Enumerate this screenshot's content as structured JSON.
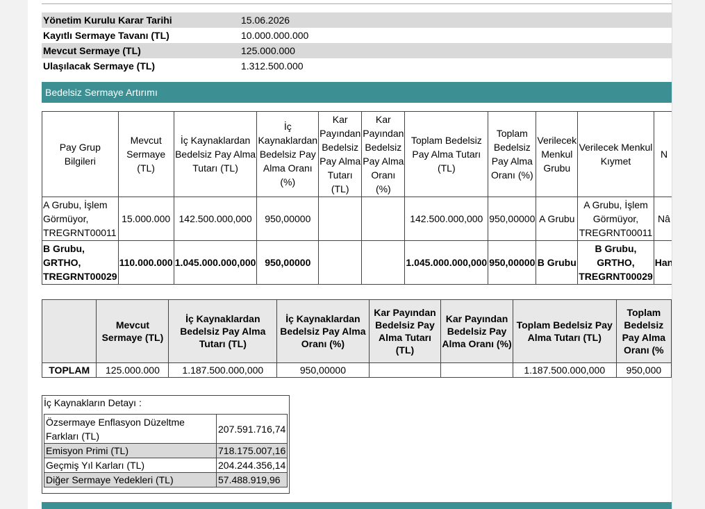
{
  "info_rows": [
    {
      "label": "Yönetim Kurulu Karar Tarihi",
      "value": "15.06.2026"
    },
    {
      "label": "Kayıtlı Sermaye Tavanı (TL)",
      "value": "10.000.000.000"
    },
    {
      "label": "Mevcut Sermaye (TL)",
      "value": "125.000.000"
    },
    {
      "label": "Ulaşılacak Sermaye (TL)",
      "value": "1.312.500.000"
    }
  ],
  "section_bedelsiz": "Bedelsiz Sermaye Artırımı",
  "group_table": {
    "headers": [
      "Pay Grup Bilgileri",
      "Mevcut Sermaye (TL)",
      "İç Kaynaklardan Bedelsiz Pay Alma Tutarı (TL)",
      "İç Kaynaklardan Bedelsiz Pay Alma Oranı (%)",
      "Kar Payından Bedelsiz Pay Alma Tutarı (TL)",
      "Kar Payından Bedelsiz Pay Alma Oranı (%)",
      "Toplam Bedelsiz Pay Alma Tutarı (TL)",
      "Toplam Bedelsiz Pay Alma Oranı (%)",
      "Verilecek Menkul Grubu",
      "Verilecek Menkul Kıymet",
      "N"
    ],
    "rows": [
      [
        "A Grubu, İşlem Görmüyor, TREGRNT00011",
        "15.000.000",
        "142.500.000,000",
        "950,00000",
        "",
        "",
        "142.500.000,000",
        "950,00000",
        "A Grubu",
        "A Grubu, İşlem Görmüyor, TREGRNT00011",
        "Nâ"
      ],
      [
        "B Grubu, GRTHO, TREGRNT00029",
        "110.000.000",
        "1.045.000.000,000",
        "950,00000",
        "",
        "",
        "1.045.000.000,000",
        "950,00000",
        "B Grubu",
        "B Grubu, GRTHO, TREGRNT00029",
        "Han"
      ]
    ]
  },
  "total_table": {
    "headers": [
      "",
      "Mevcut Sermaye (TL)",
      "İç Kaynaklardan Bedelsiz Pay Alma Tutarı (TL)",
      "İç Kaynaklardan Bedelsiz Pay Alma Oranı (%)",
      "Kar Payından Bedelsiz Pay Alma Tutarı (TL)",
      "Kar Payından Bedelsiz Pay Alma Oranı (%)",
      "Toplam Bedelsiz Pay Alma Tutarı (TL)",
      "Toplam Bedelsiz Pay Alma Oranı (%"
    ],
    "row": [
      "TOPLAM",
      "125.000.000",
      "1.187.500.000,000",
      "950,00000",
      "",
      "",
      "1.187.500.000,000",
      "950,000"
    ]
  },
  "detail": {
    "caption": "İç Kaynakların Detayı :",
    "rows": [
      {
        "label": "Özsermaye Enflasyon Düzeltme Farkları (TL)",
        "value": "207.591.716,74"
      },
      {
        "label": "Emisyon Primi (TL)",
        "value": "718.175.007,16"
      },
      {
        "label": "Geçmiş Yıl Karları (TL)",
        "value": "204.244.356,14"
      },
      {
        "label": "Diğer Sermaye Yedekleri (TL)",
        "value": "57.488.919,96"
      }
    ]
  }
}
